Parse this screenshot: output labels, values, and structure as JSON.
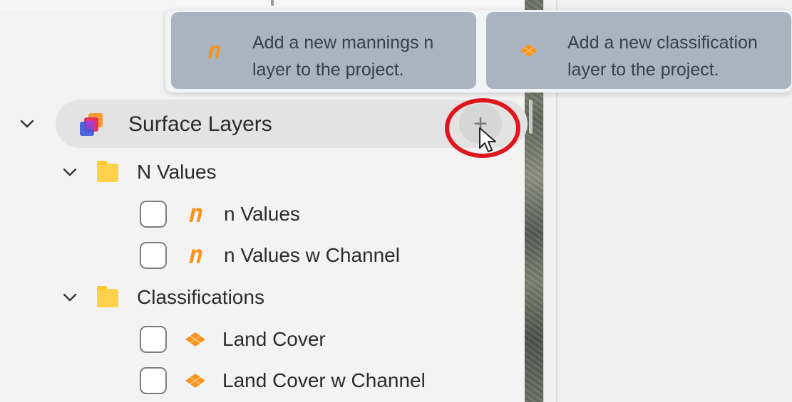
{
  "flyout": {
    "mannings_tile": {
      "line1": "Add a new mannings n",
      "line2": "layer to the project.",
      "icon": "mannings-n-icon"
    },
    "classification_tile": {
      "line1": "Add a new classification",
      "line2": "layer to the project.",
      "icon": "classification-layer-icon"
    }
  },
  "tree": {
    "header": {
      "label": "Surface Layers",
      "add_symbol": "+",
      "icon": "surface-layers-icon"
    },
    "groups": [
      {
        "label": "N Values",
        "items": [
          {
            "label": "n Values",
            "checked": false
          },
          {
            "label": "n Values w Channel",
            "checked": false
          }
        ]
      },
      {
        "label": "Classifications",
        "items": [
          {
            "label": "Land Cover",
            "checked": false
          },
          {
            "label": "Land Cover w Channel",
            "checked": false
          }
        ]
      }
    ]
  },
  "colors": {
    "accent_orange": "#f7941d",
    "highlight_red": "#e0161f",
    "folder_yellow": "#ffd04a",
    "tile_bg": "#aab4c0"
  }
}
